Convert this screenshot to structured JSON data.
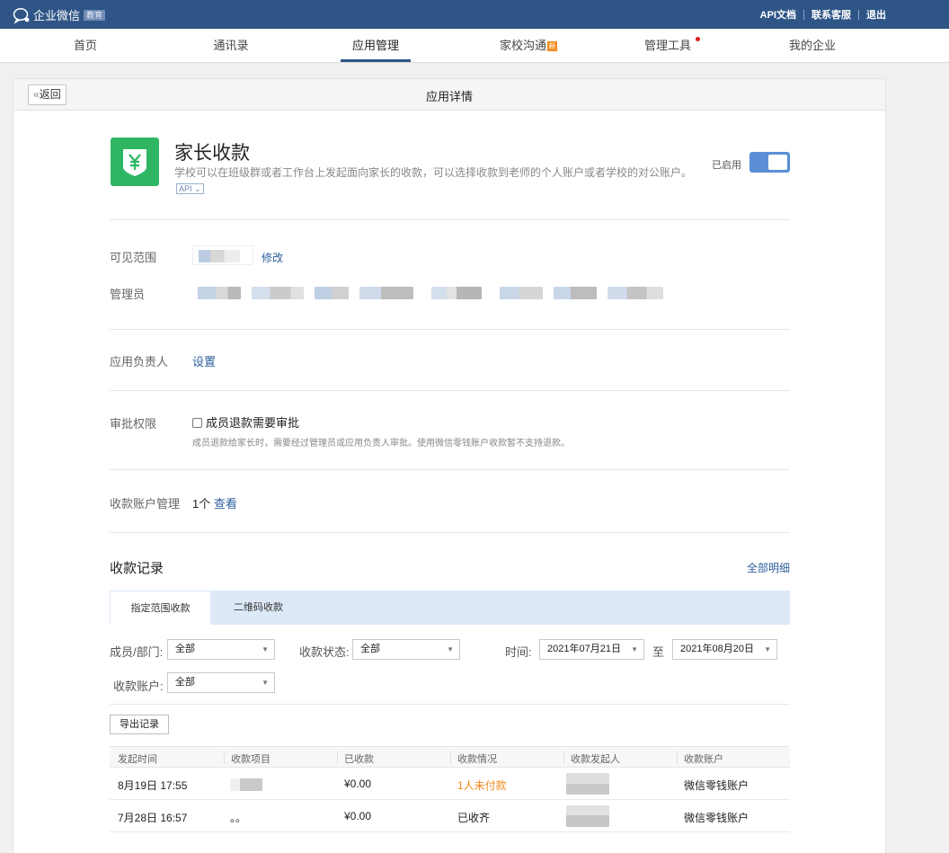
{
  "topbar": {
    "logo_text": "企业微信",
    "logo_badge": "教育",
    "links": [
      "API文档",
      "联系客服",
      "退出"
    ]
  },
  "nav": {
    "items": [
      {
        "label": "首页"
      },
      {
        "label": "通讯录"
      },
      {
        "label": "应用管理"
      },
      {
        "label": "家校沟通",
        "badge": "新"
      },
      {
        "label": "管理工具"
      },
      {
        "label": "我的企业"
      }
    ],
    "active_index": 2
  },
  "panel": {
    "back_label": "返回",
    "title": "应用详情"
  },
  "app": {
    "icon": "yen-shield-icon",
    "name": "家长收款",
    "description": "学校可以在班级群或者工作台上发起面向家长的收款，可以选择收款到老师的个人账户或者学校的对公账户。",
    "api_tag": "API",
    "status_label": "已启用",
    "enabled": true
  },
  "visibility": {
    "label": "可见范围",
    "edit_link": "修改"
  },
  "admins": {
    "label": "管理员"
  },
  "owner": {
    "label": "应用负责人",
    "set_link": "设置"
  },
  "approval": {
    "label": "审批权限",
    "checkbox_label": "成员退款需要审批",
    "checked": false,
    "hint": "成员退款给家长时，需要经过管理员或应用负责人审批。使用微信零钱账户收款暂不支持退款。"
  },
  "accounts": {
    "label": "收款账户管理",
    "count": "1个",
    "view_link": "查看"
  },
  "records": {
    "title": "收款记录",
    "all_link": "全部明细",
    "tabs": [
      "指定范围收款",
      "二维码收款"
    ],
    "active_tab": 0,
    "filters": {
      "member_label": "成员/部门:",
      "member_value": "全部",
      "status_label": "收款状态:",
      "status_value": "全部",
      "time_label": "时间:",
      "time_from": "2021年07月21日",
      "time_to_label": "至",
      "time_to": "2021年08月20日",
      "account_label": "收款账户:",
      "account_value": "全部"
    },
    "export_button": "导出记录",
    "columns": [
      "发起时间",
      "收款项目",
      "已收款",
      "收款情况",
      "收款发起人",
      "收款账户"
    ],
    "rows": [
      {
        "time": "8月19日 17:55",
        "item": "",
        "received": "¥0.00",
        "status": "1人未付款",
        "status_color": "#f08a18",
        "initiator": "",
        "account": "微信零钱账户"
      },
      {
        "time": "7月28日 16:57",
        "item": "。。",
        "received": "¥0.00",
        "status": "已收齐",
        "status_color": "#222222",
        "initiator": "",
        "account": "微信零钱账户"
      }
    ]
  },
  "colors": {
    "topbar": "#2e5586",
    "toggle_on": "#5a8fd6",
    "app_icon": "#2fb663",
    "link": "#2e5f9b",
    "warning": "#f08a18",
    "tab_strip": "#dde9f7"
  }
}
